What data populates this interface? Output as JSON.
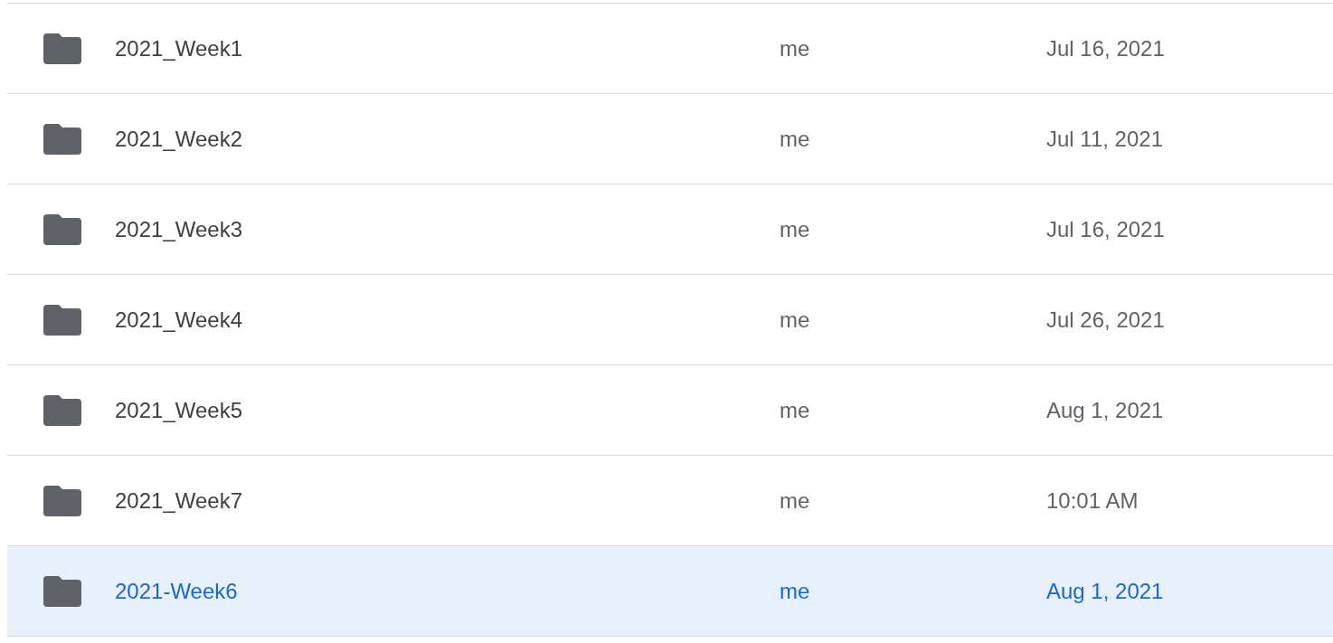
{
  "files": [
    {
      "name": "2021_Week1",
      "owner": "me",
      "modified": "Jul 16, 2021",
      "selected": false
    },
    {
      "name": "2021_Week2",
      "owner": "me",
      "modified": "Jul 11, 2021",
      "selected": false
    },
    {
      "name": "2021_Week3",
      "owner": "me",
      "modified": "Jul 16, 2021",
      "selected": false
    },
    {
      "name": "2021_Week4",
      "owner": "me",
      "modified": "Jul 26, 2021",
      "selected": false
    },
    {
      "name": "2021_Week5",
      "owner": "me",
      "modified": "Aug 1, 2021",
      "selected": false
    },
    {
      "name": "2021_Week7",
      "owner": "me",
      "modified": "10:01 AM",
      "selected": false
    },
    {
      "name": "2021-Week6",
      "owner": "me",
      "modified": "Aug 1, 2021",
      "selected": true
    }
  ]
}
